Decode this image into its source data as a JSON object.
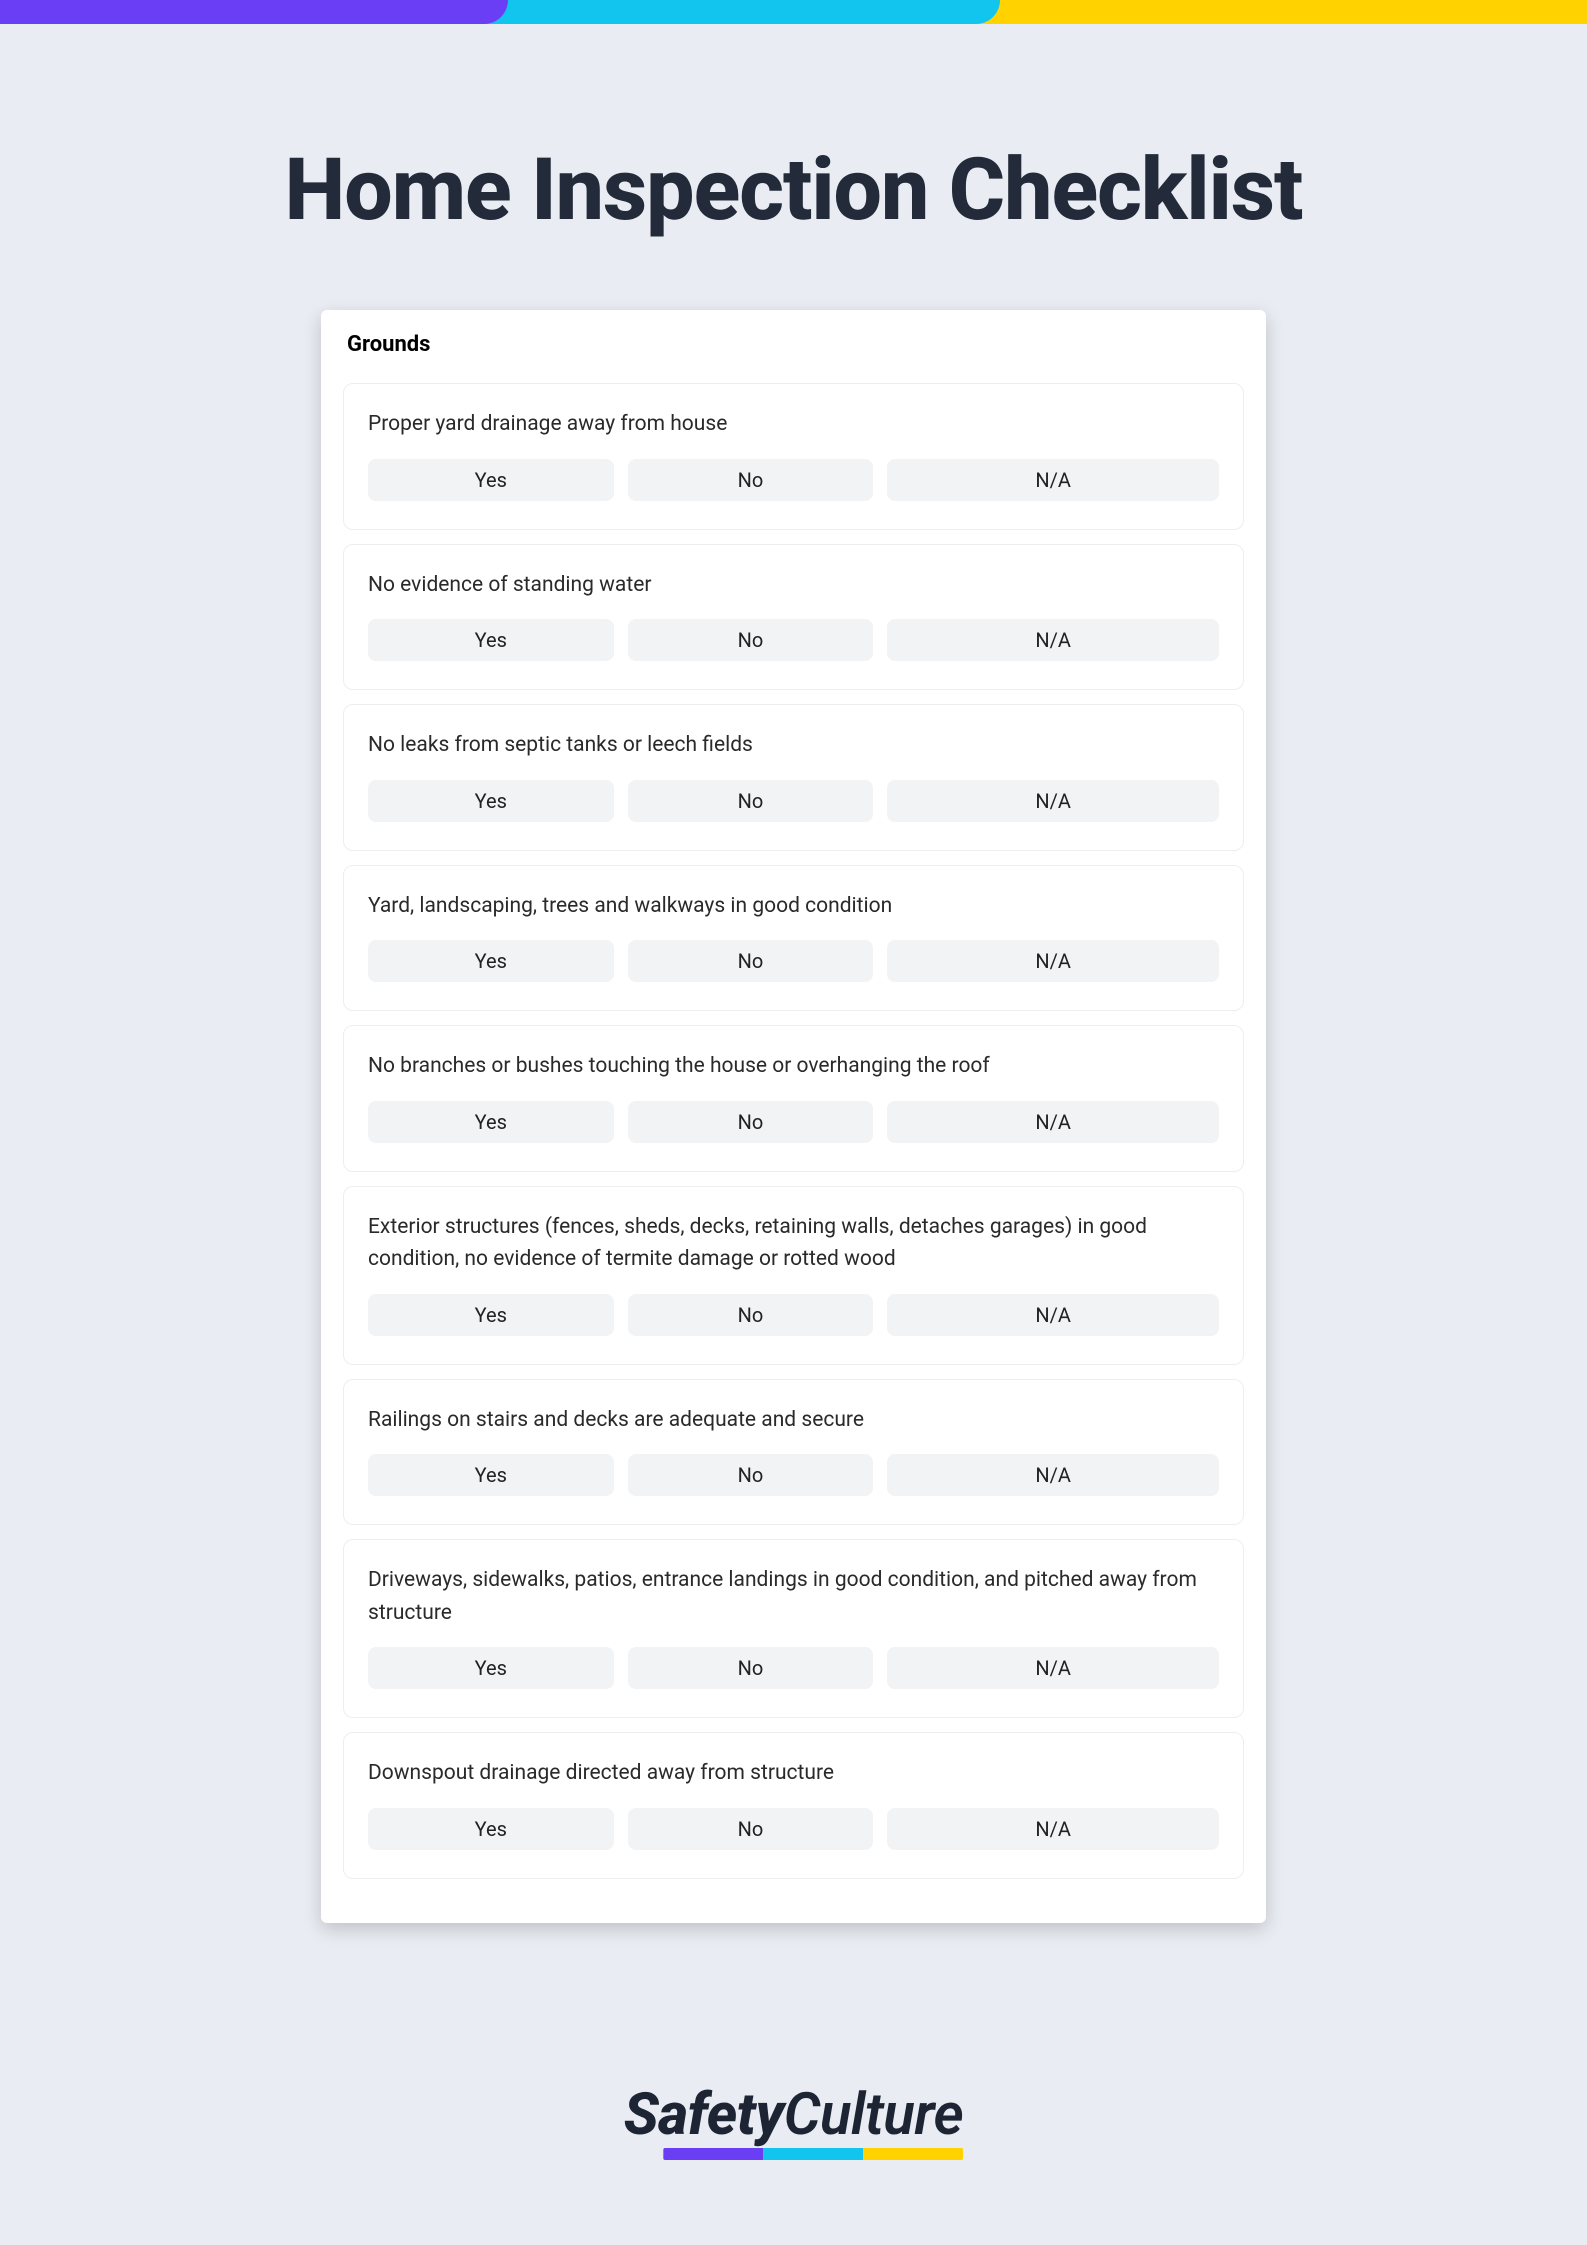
{
  "title": "Home Inspection Checklist",
  "section": "Grounds",
  "options": {
    "yes": "Yes",
    "no": "No",
    "na": "N/A"
  },
  "questions": [
    {
      "text": "Proper yard drainage away from house"
    },
    {
      "text": "No evidence of standing water"
    },
    {
      "text": "No leaks from septic tanks or leech fields"
    },
    {
      "text": "Yard, landscaping, trees and walkways in good condition"
    },
    {
      "text": "No branches or bushes touching the house or overhanging the roof"
    },
    {
      "text": "Exterior structures (fences, sheds, decks, retaining walls, detaches garages) in good condition, no evidence of termite damage or rotted wood"
    },
    {
      "text": "Railings on stairs and decks are adequate and secure"
    },
    {
      "text": "Driveways, sidewalks, patios, entrance landings in good condition, and pitched away from structure"
    },
    {
      "text": "Downspout drainage directed away from structure"
    }
  ],
  "brand": {
    "part1": "Safety",
    "part2": "Culture"
  }
}
